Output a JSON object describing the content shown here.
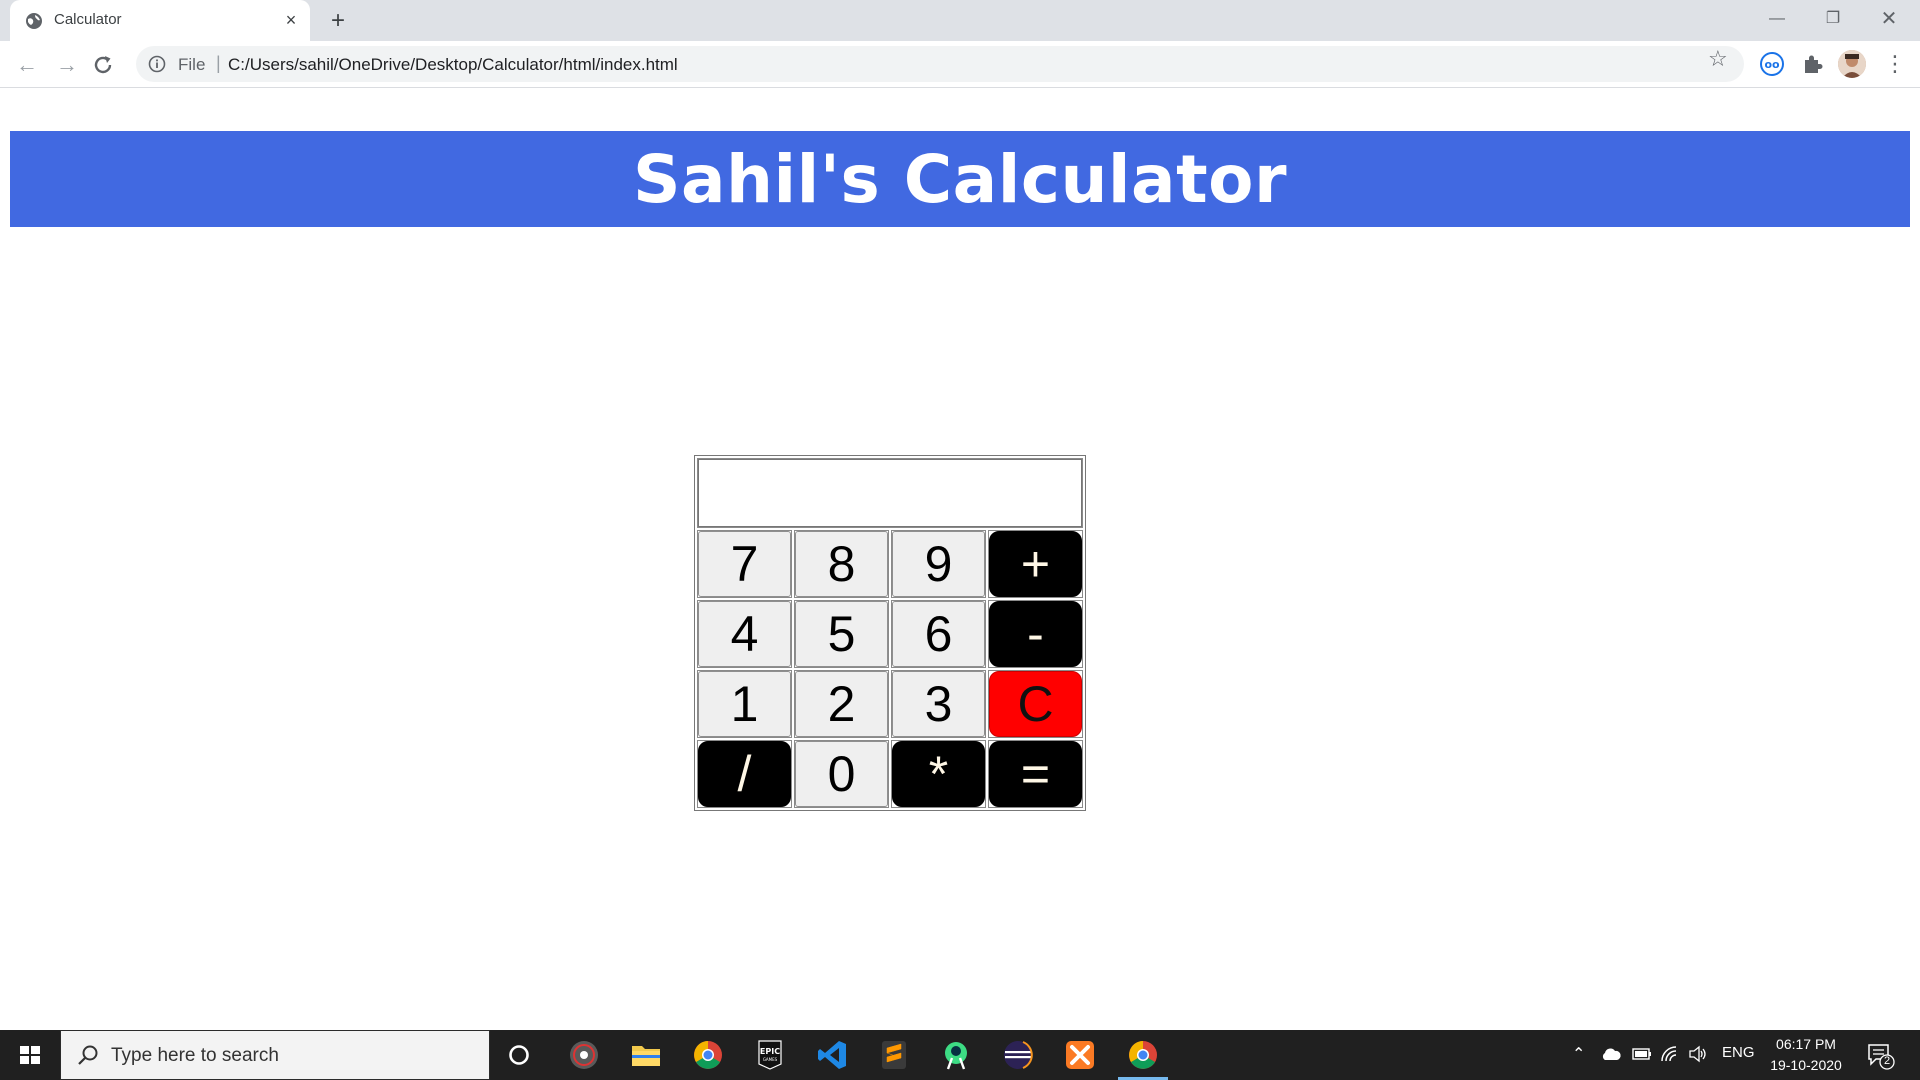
{
  "browser": {
    "tab_title": "Calculator",
    "tab_close": "×",
    "new_tab": "+",
    "url_scheme": "File",
    "url_separator": "|",
    "url": "C:/Users/sahil/OneDrive/Desktop/Calculator/html/index.html",
    "icons": [
      "globe-icon",
      "close-icon",
      "plus-icon",
      "back-arrow-icon",
      "forward-arrow-icon",
      "reload-icon",
      "info-icon",
      "star-icon",
      "extension-icon",
      "puzzle-icon",
      "avatar",
      "more-icon"
    ]
  },
  "page": {
    "heading": "Sahil's Calculator",
    "display_value": "",
    "keys": [
      [
        "7",
        "8",
        "9",
        "+"
      ],
      [
        "4",
        "5",
        "6",
        "-"
      ],
      [
        "1",
        "2",
        "3",
        "C"
      ],
      [
        "/",
        "0",
        "*",
        "="
      ]
    ],
    "colors": {
      "banner": "#4169e1",
      "operator_key": "#000000",
      "clear_key": "#ff0000",
      "digit_key": "#efefef"
    }
  },
  "taskbar": {
    "search_placeholder": "Type here to search",
    "language": "ENG",
    "time": "06:17 PM",
    "date": "19-10-2020",
    "notification_count": "2",
    "pinned_apps": [
      "cortana-icon",
      "obs-icon",
      "file-explorer-icon",
      "chrome-icon",
      "epic-games-icon",
      "vscode-icon",
      "sublime-text-icon",
      "android-studio-icon",
      "eclipse-icon",
      "xampp-icon",
      "chrome-icon-active"
    ]
  }
}
